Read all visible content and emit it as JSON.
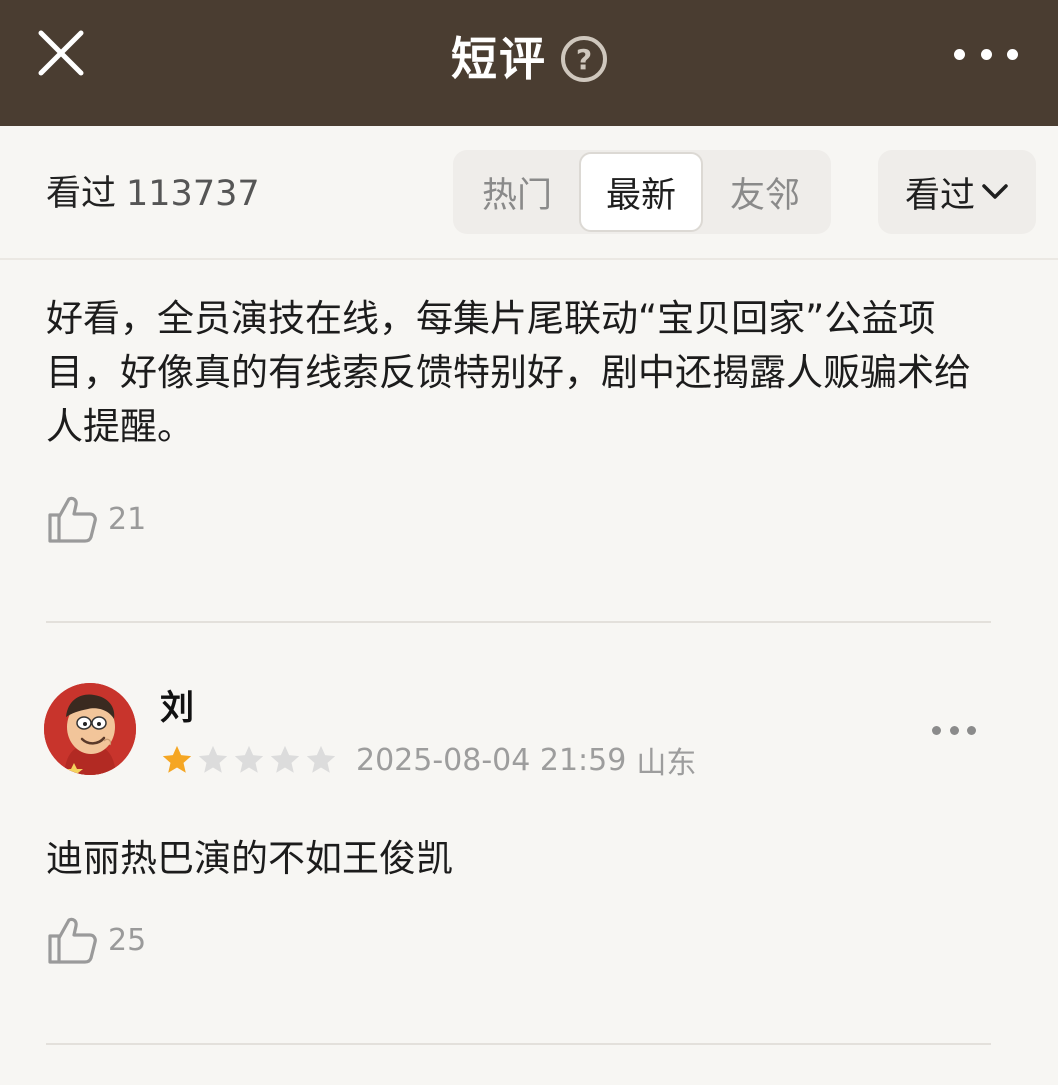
{
  "header": {
    "title": "短评",
    "help_glyph": "?",
    "close_icon": "close-icon",
    "more_icon": "more-icon"
  },
  "filter_bar": {
    "seen_label": "看过",
    "seen_count": "113737",
    "tabs": [
      {
        "label": "热门",
        "active": false
      },
      {
        "label": "最新",
        "active": true
      },
      {
        "label": "友邻",
        "active": false
      }
    ],
    "status_filter": {
      "label": "看过",
      "icon": "chevron-down-icon"
    }
  },
  "comments": [
    {
      "text": "好看，全员演技在线，每集片尾联动“宝贝回家”公益项目，好像真的有线索反馈特别好，剧中还揭露人贩骗术给人提醒。",
      "likes": "21"
    },
    {
      "username": "刘",
      "rating": 1,
      "rating_max": 5,
      "date": "2025-08-04 21:59",
      "location": "山东",
      "text": "迪丽热巴演的不如王俊凯",
      "likes": "25"
    }
  ],
  "colors": {
    "header_bg": "#4a3d31",
    "page_bg": "#f7f6f3",
    "star_on": "#f5a623",
    "star_off": "#dcdcdc"
  }
}
